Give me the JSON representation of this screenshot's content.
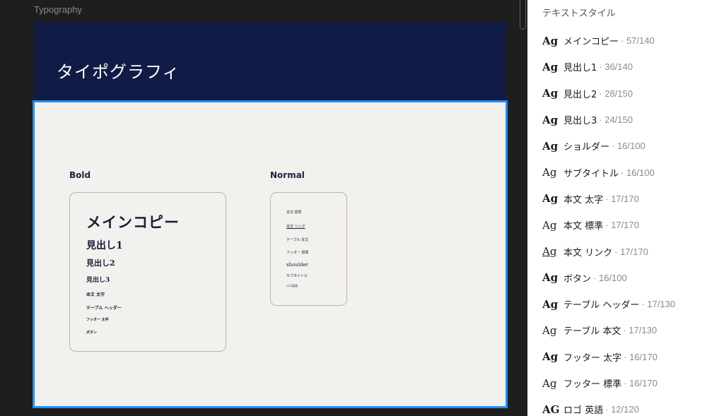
{
  "canvas": {
    "frame_label": "Typography",
    "hero_title": "タイポグラフィ",
    "bold_heading": "Bold",
    "normal_heading": "Normal",
    "bold_samples": [
      "メインコピー",
      "見出し1",
      "見出し2",
      "見出し3",
      "本文 太字",
      "テーブル ヘッダー",
      "フッター 太字",
      "ボタン"
    ],
    "normal_samples": [
      "本文 標準",
      "本文 リンク",
      "テーブル 本文",
      "フッター 標準",
      "shoulder",
      "サブタイトル",
      "ロゴ英語"
    ]
  },
  "panel": {
    "title": "テキストスタイル",
    "styles": [
      {
        "ag": "Ag",
        "weight": "bold",
        "name": "メインコピー",
        "meta": "· 57/140"
      },
      {
        "ag": "Ag",
        "weight": "bold",
        "name": "見出し1",
        "meta": "· 36/140"
      },
      {
        "ag": "Ag",
        "weight": "bold",
        "name": "見出し2",
        "meta": "· 28/150"
      },
      {
        "ag": "Ag",
        "weight": "bold",
        "name": "見出し3",
        "meta": "· 24/150"
      },
      {
        "ag": "Ag",
        "weight": "bold",
        "name": "ショルダー",
        "meta": "· 16/100"
      },
      {
        "ag": "Ag",
        "weight": "normal",
        "name": "サブタイトル",
        "meta": "· 16/100"
      },
      {
        "ag": "Ag",
        "weight": "bold",
        "name": "本文 太字",
        "meta": "· 17/170"
      },
      {
        "ag": "Ag",
        "weight": "normal",
        "name": "本文 標準",
        "meta": "· 17/170"
      },
      {
        "ag": "Ag",
        "weight": "underline",
        "name": "本文 リンク",
        "meta": "· 17/170"
      },
      {
        "ag": "Ag",
        "weight": "bold",
        "name": "ボタン",
        "meta": "· 16/100"
      },
      {
        "ag": "Ag",
        "weight": "bold",
        "name": "テーブル ヘッダー",
        "meta": "· 17/130"
      },
      {
        "ag": "Ag",
        "weight": "normal",
        "name": "テーブル 本文",
        "meta": "· 17/130"
      },
      {
        "ag": "Ag",
        "weight": "bold",
        "name": "フッター 太字",
        "meta": "· 16/170"
      },
      {
        "ag": "Ag",
        "weight": "normal",
        "name": "フッター 標準",
        "meta": "· 16/170"
      },
      {
        "ag": "AG",
        "weight": "bold",
        "name": "ロゴ 英語",
        "meta": "· 12/120"
      }
    ]
  },
  "colors": {
    "hero_bg": "#111c46",
    "selection": "#1e8ff4",
    "section_bg": "#f3f1ed"
  }
}
